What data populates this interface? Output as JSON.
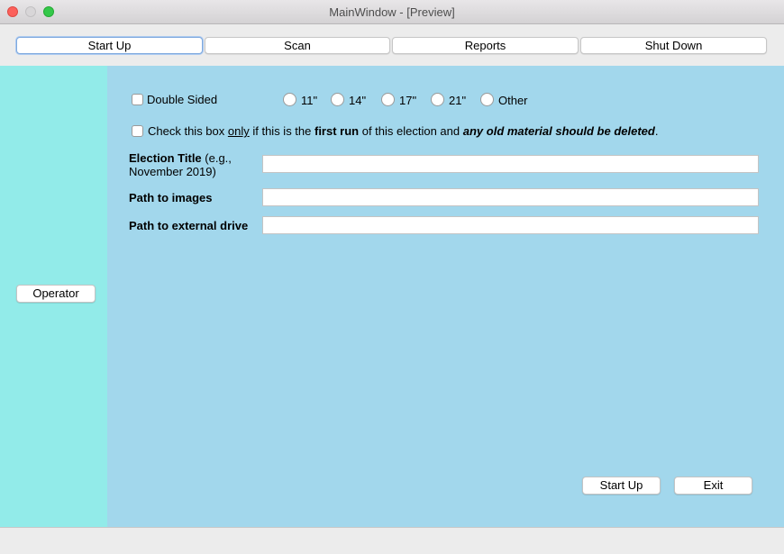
{
  "window": {
    "title": "MainWindow - [Preview]"
  },
  "tabs": [
    {
      "label": "Start Up",
      "active": true
    },
    {
      "label": "Scan",
      "active": false
    },
    {
      "label": "Reports",
      "active": false
    },
    {
      "label": "Shut Down",
      "active": false
    }
  ],
  "sidebar": {
    "operator_label": "Operator"
  },
  "options": {
    "double_sided_label": "Double Sided",
    "double_sided_checked": false,
    "sizes": [
      "11\"",
      "14\"",
      "17\"",
      "21\"",
      "Other"
    ],
    "first_run": {
      "p1": "Check this box ",
      "only": "only",
      "p2": " if this is the ",
      "first_run": "first run",
      "p3": " of this election and ",
      "emphasis": "any old material should be deleted",
      "p4": ".",
      "checked": false
    }
  },
  "fields": {
    "election_title": {
      "label": "Election Title",
      "hint": " (e.g., November 2019)",
      "value": ""
    },
    "path_images": {
      "label": "Path to images",
      "value": ""
    },
    "path_external": {
      "label": "Path to external drive",
      "value": ""
    }
  },
  "buttons": {
    "start_up": "Start Up",
    "exit": "Exit"
  },
  "colors": {
    "left_panel": "#92ebe9",
    "main_panel": "#a2d7ec",
    "close": "#fc605b",
    "maximize": "#34c84a"
  }
}
